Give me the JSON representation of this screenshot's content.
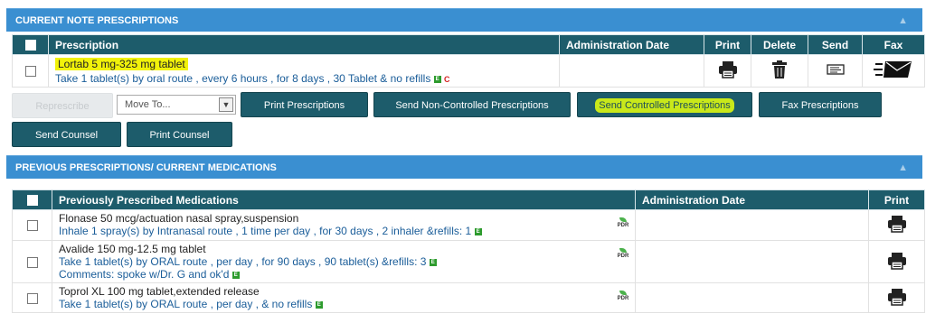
{
  "current": {
    "section_title": "CURRENT NOTE PRESCRIPTIONS",
    "headers": {
      "prescription": "Prescription",
      "admin_date": "Administration Date",
      "print": "Print",
      "delete": "Delete",
      "send": "Send",
      "fax": "Fax"
    },
    "row": {
      "drug": "Lortab 5 mg-325 mg tablet",
      "sig": "Take 1 tablet(s) by oral route , every 6 hours , for 8 days , 30 Tablet & no refills",
      "e_badge": "E",
      "c_mark": "C",
      "admin_date": ""
    },
    "buttons": {
      "represcribe": "Represcribe",
      "move_to": "Move To...",
      "print_prescriptions": "Print Prescriptions",
      "send_non_controlled": "Send Non-Controlled Prescriptions",
      "send_controlled": "Send Controlled Prescriptions",
      "fax_prescriptions": "Fax Prescriptions",
      "send_counsel": "Send Counsel",
      "print_counsel": "Print Counsel"
    }
  },
  "previous": {
    "section_title": "PREVIOUS PRESCRIPTIONS/ CURRENT MEDICATIONS",
    "headers": {
      "meds": "Previously Prescribed Medications",
      "admin_date": "Administration Date",
      "print": "Print"
    },
    "rows": [
      {
        "drug": "Flonase 50 mcg/actuation nasal spray,suspension",
        "sig": "Inhale 1 spray(s) by Intranasal route , 1 time per day , for 30 days , 2 inhaler &refills: 1",
        "comment": "",
        "e_badge": "E",
        "pdr": "PDR"
      },
      {
        "drug": "Avalide 150 mg-12.5 mg tablet",
        "sig": "Take 1 tablet(s) by ORAL route , per day , for 90 days , 90 tablet(s) &refills: 3",
        "comment": "Comments: spoke w/Dr. G and ok'd",
        "e_badge": "E",
        "pdr": "PDR"
      },
      {
        "drug": "Toprol XL 100 mg tablet,extended release",
        "sig": "Take 1 tablet(s) by ORAL route , per day , & no refills",
        "comment": "",
        "e_badge": "E",
        "pdr": "PDR"
      }
    ]
  },
  "icons": {
    "caret": "▲",
    "select_arrow": "▼"
  }
}
